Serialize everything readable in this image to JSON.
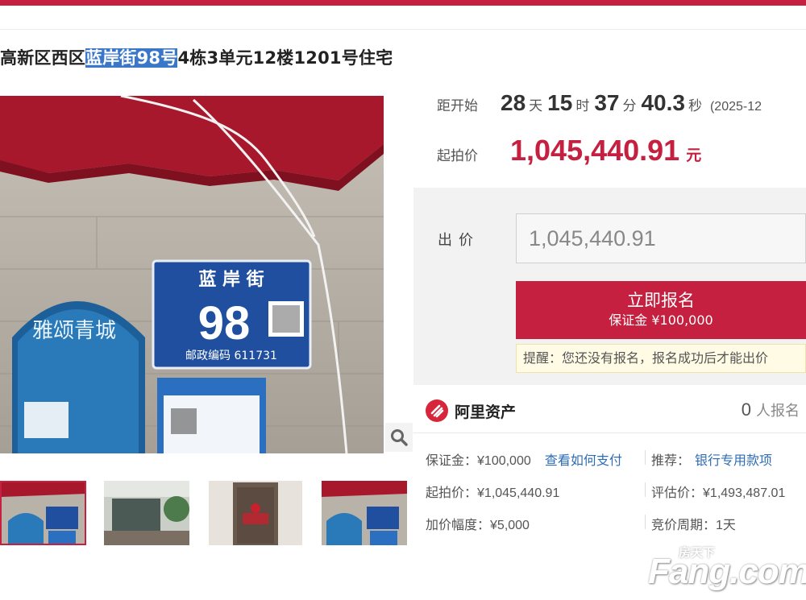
{
  "listing": {
    "title_prefix": "高新区西区",
    "title_highlight": "蓝岸街98号",
    "title_suffix": "4栋3单元12楼1201号住宅"
  },
  "photo": {
    "sign_street": "蓝 岸 街",
    "sign_number": "98",
    "sign_postcode": "邮政编码 611731",
    "poster_text": "雅颂青城"
  },
  "countdown": {
    "label": "距开始",
    "days": "28",
    "days_unit": "天",
    "hours": "15",
    "hours_unit": "时",
    "minutes": "37",
    "minutes_unit": "分",
    "seconds": "40.3",
    "seconds_unit": "秒",
    "date": "(2025-12"
  },
  "start_price": {
    "label": "起拍价",
    "value": "1,045,440.91",
    "unit": "元"
  },
  "bid": {
    "label": "出价",
    "input_value": "1,045,440.91",
    "signup_label": "立即报名",
    "deposit_label": "保证金 ¥100,000",
    "notice": "提醒：您还没有报名，报名成功后才能出价"
  },
  "org": {
    "name": "阿里资产",
    "registered_count": "0",
    "registered_label": "人报名"
  },
  "details": {
    "deposit_label": "保证金：",
    "deposit_value": "¥100,000",
    "deposit_link": "查看如何支付",
    "recommend_label": "推荐：",
    "recommend_link": "银行专用款项",
    "start_price_label": "起拍价：",
    "start_price_value": "¥1,045,440.91",
    "appraisal_label": "评估价：",
    "appraisal_value": "¥1,493,487.01",
    "increment_label": "加价幅度：",
    "increment_value": "¥5,000",
    "cycle_label": "竞价周期：",
    "cycle_value": "1天"
  },
  "watermark": {
    "main": "Fang.com",
    "small": "房天下"
  },
  "colors": {
    "accent": "#c5203f",
    "link": "#2e6db4",
    "highlight": "#3a77c9"
  }
}
